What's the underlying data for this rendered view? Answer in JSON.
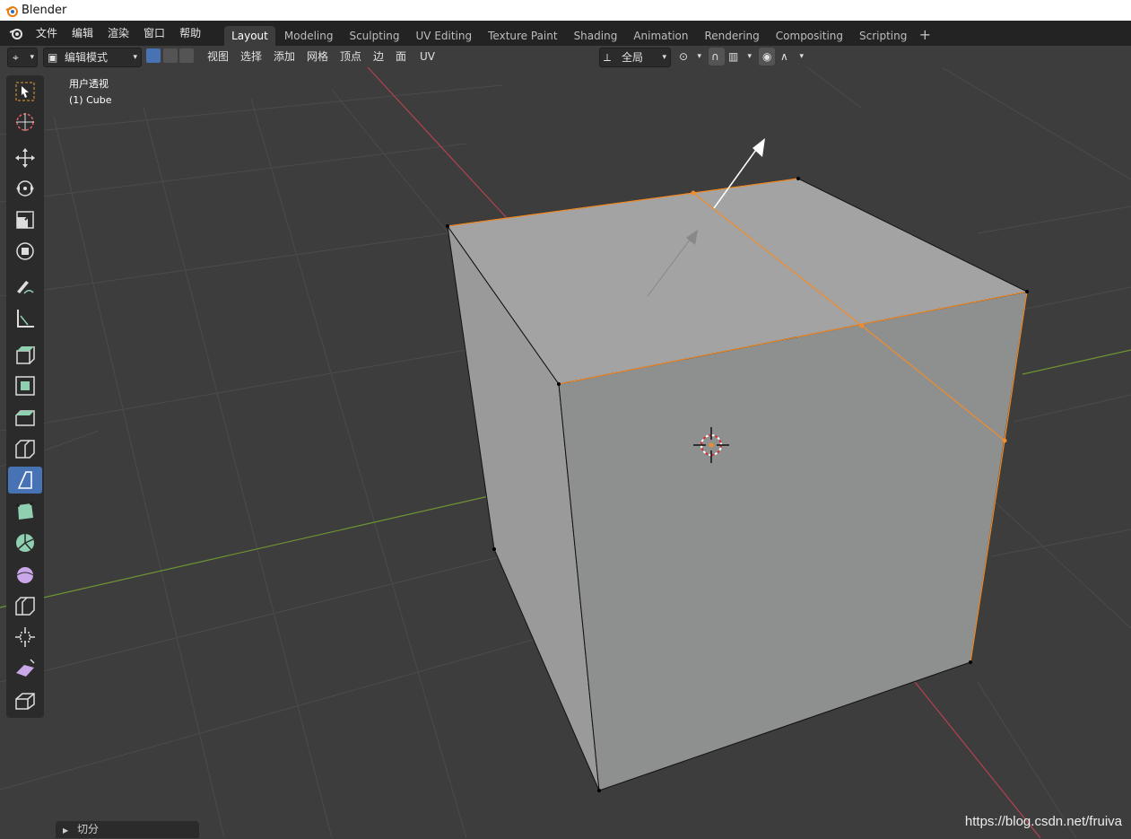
{
  "window": {
    "title": "Blender"
  },
  "menus": [
    "文件",
    "编辑",
    "渲染",
    "窗口",
    "帮助"
  ],
  "workspace_tabs": [
    "Layout",
    "Modeling",
    "Sculpting",
    "UV Editing",
    "Texture Paint",
    "Shading",
    "Animation",
    "Rendering",
    "Compositing",
    "Scripting"
  ],
  "active_tab": "Layout",
  "header": {
    "mode": "编辑模式",
    "menus": [
      "视图",
      "选择",
      "添加",
      "网格",
      "顶点",
      "边",
      "面",
      "UV"
    ],
    "transform_orientation": "全局"
  },
  "viewport": {
    "view_name": "用户透视",
    "object_name": "(1) Cube"
  },
  "tools": [
    {
      "name": "select-box-icon"
    },
    {
      "name": "cursor-icon"
    },
    {
      "name": "move-icon"
    },
    {
      "name": "rotate-icon"
    },
    {
      "name": "scale-icon"
    },
    {
      "name": "transform-icon"
    },
    {
      "name": "annotate-icon"
    },
    {
      "name": "measure-icon"
    },
    {
      "name": "extrude-icon"
    },
    {
      "name": "inset-icon"
    },
    {
      "name": "bevel-icon"
    },
    {
      "name": "loop-cut-icon"
    },
    {
      "name": "knife-icon"
    },
    {
      "name": "poly-build-icon"
    },
    {
      "name": "spin-icon"
    },
    {
      "name": "smooth-icon"
    },
    {
      "name": "edge-slide-icon"
    },
    {
      "name": "shrink-fatten-icon"
    },
    {
      "name": "shear-icon"
    },
    {
      "name": "rip-region-icon"
    }
  ],
  "active_tool": "knife-icon",
  "last_operator": {
    "label": "切分"
  },
  "watermark": "https://blog.csdn.net/fruiva",
  "colors": {
    "background": "#3d3d3d",
    "grid": "#4a4a4a",
    "x_axis": "#b3424f",
    "y_axis": "#6f9533",
    "selection": "#f28c28",
    "cube_top": "#a3a3a3",
    "cube_front": "#8e8f8f",
    "cube_left": "#9a9a9a",
    "active_blue": "#4772b3"
  }
}
